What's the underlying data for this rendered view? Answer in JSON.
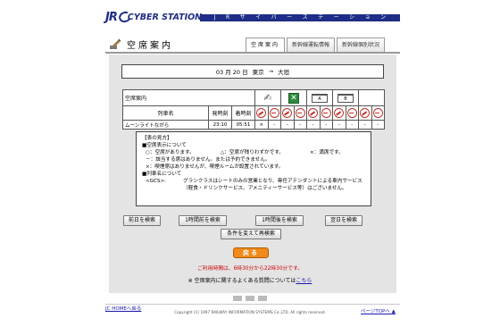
{
  "header": {
    "logo_jr": "JR",
    "logo_text": "CYBER STATION",
    "banner_chars": [
      "J",
      "R",
      "サ",
      "イ",
      "バ",
      "ー",
      "ス",
      "テ",
      "ー",
      "シ",
      "ョ",
      "ン"
    ]
  },
  "page": {
    "title": "空席案内",
    "tabs": [
      "空席案内",
      "新幹線運転情報",
      "新幹線個別状況"
    ]
  },
  "route": {
    "date": "03 月 20 日",
    "from": "東京",
    "arrow": "→",
    "to": "大垣"
  },
  "seat_table": {
    "label_seat_info": "空席案内",
    "col_train": "列車名",
    "col_depart": "発時刻",
    "col_arrive": "着時刻",
    "class_icons": [
      "hand-icon",
      "green-car-icon",
      "reserved-a-icon",
      "reserved-b-icon"
    ],
    "row": {
      "train": "ムーンライトながら",
      "depart": "23:10",
      "arrive": "05:51",
      "marks": [
        "×",
        "-",
        "-",
        "-",
        "-",
        "-",
        "-",
        "-",
        "-",
        "-"
      ]
    }
  },
  "legend": {
    "heading": "【表の見方】",
    "seat_heading": "■空席表示について",
    "symbols": [
      "○：空席があります。",
      "△：空席が残りわずかです。",
      "×：満席です。"
    ],
    "dash": "－：該当する席はありません。または予約できません。",
    "x_smoke": "×：喫煙席はありませんが、喫煙ルームが設置されています。",
    "train_heading": "■列車名について",
    "gcs_key": "<GCS>:",
    "gcs_value": "グランクラスはシートのみの営業となり、専任アテンダントによる車内サービス（軽食・ドリンクサービス、アメニティーサービス等）はございません。"
  },
  "buttons": {
    "prev_day": "前日を検索",
    "prev_hour": "1時間前を検索",
    "next_hour": "1時間後を検索",
    "next_day": "翌日を検索",
    "change": "条件を変えて再検索",
    "back": "戻る"
  },
  "info": {
    "hours": "ご利用時間は、6時30分から22時30分です。",
    "faq_prefix": "※ 空席案内に関するよくある質問については",
    "faq_link": "こちら"
  },
  "footer": {
    "home": "JC HOMEへ戻る",
    "top": "ページTOPへ ▲",
    "copyright": "Copyright (C) 1997 RAILWAY INFORMATION SYSTEMS Co.,LTD. All rights reserved."
  }
}
